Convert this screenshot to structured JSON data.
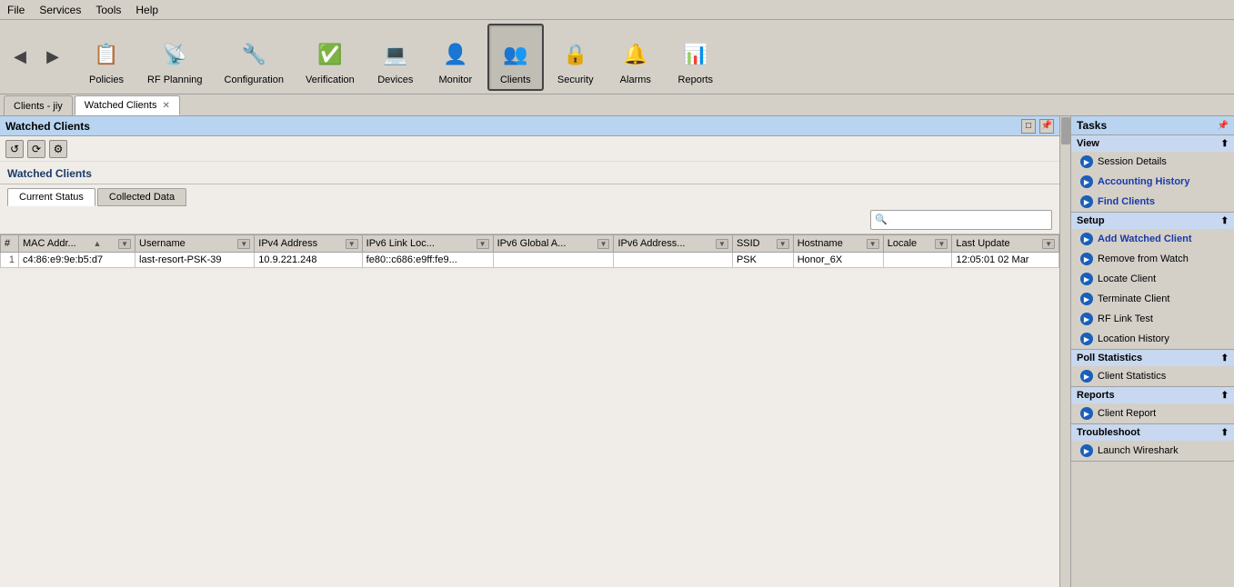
{
  "menu": {
    "items": [
      "File",
      "Services",
      "Tools",
      "Help"
    ]
  },
  "toolbar": {
    "nav": {
      "back_label": "◀",
      "forward_label": "▶"
    },
    "buttons": [
      {
        "id": "policies",
        "label": "Policies",
        "icon": "📋",
        "active": false
      },
      {
        "id": "rfplanning",
        "label": "RF Planning",
        "icon": "📡",
        "active": false
      },
      {
        "id": "configuration",
        "label": "Configuration",
        "icon": "🔧",
        "active": false
      },
      {
        "id": "verification",
        "label": "Verification",
        "icon": "✅",
        "active": false
      },
      {
        "id": "devices",
        "label": "Devices",
        "icon": "💻",
        "active": false
      },
      {
        "id": "monitor",
        "label": "Monitor",
        "icon": "👤",
        "active": false
      },
      {
        "id": "clients",
        "label": "Clients",
        "icon": "👥",
        "active": true
      },
      {
        "id": "security",
        "label": "Security",
        "icon": "🔒",
        "active": false
      },
      {
        "id": "alarms",
        "label": "Alarms",
        "icon": "🔔",
        "active": false
      },
      {
        "id": "reports",
        "label": "Reports",
        "icon": "📊",
        "active": false
      }
    ]
  },
  "tabs": [
    {
      "id": "clients-jiy",
      "label": "Clients - jiy",
      "closable": false,
      "active": false
    },
    {
      "id": "watched-clients",
      "label": "Watched Clients",
      "closable": true,
      "active": true
    }
  ],
  "panel": {
    "title": "Watched Clients",
    "section_title": "Watched Clients",
    "sub_tabs": [
      {
        "id": "current-status",
        "label": "Current Status",
        "active": true
      },
      {
        "id": "collected-data",
        "label": "Collected Data",
        "active": false
      }
    ],
    "search_placeholder": "🔍",
    "table": {
      "columns": [
        {
          "id": "num",
          "label": "#",
          "sortable": false,
          "dropdown": false
        },
        {
          "id": "mac",
          "label": "MAC Addr...",
          "sortable": true,
          "dropdown": true
        },
        {
          "id": "username",
          "label": "Username",
          "sortable": false,
          "dropdown": true
        },
        {
          "id": "ipv4",
          "label": "IPv4 Address",
          "sortable": false,
          "dropdown": true
        },
        {
          "id": "ipv6link",
          "label": "IPv6 Link Loc...",
          "sortable": false,
          "dropdown": true
        },
        {
          "id": "ipv6global",
          "label": "IPv6 Global A...",
          "sortable": false,
          "dropdown": true
        },
        {
          "id": "ipv6addr",
          "label": "IPv6 Address...",
          "sortable": false,
          "dropdown": true
        },
        {
          "id": "ssid",
          "label": "SSID",
          "sortable": false,
          "dropdown": true
        },
        {
          "id": "hostname",
          "label": "Hostname",
          "sortable": false,
          "dropdown": true
        },
        {
          "id": "locale",
          "label": "Locale",
          "sortable": false,
          "dropdown": true
        },
        {
          "id": "lastupdate",
          "label": "Last Update",
          "sortable": false,
          "dropdown": true
        }
      ],
      "rows": [
        {
          "num": "1",
          "mac": "c4:86:e9:9e:b5:d7",
          "username": "last-resort-PSK-39",
          "ipv4": "10.9.221.248",
          "ipv6link": "fe80::c686:e9ff:fe9...",
          "ipv6global": "",
          "ipv6addr": "",
          "ssid": "PSK",
          "hostname": "Honor_6X",
          "locale": "",
          "lastupdate": "12:05:01  02 Mar"
        }
      ]
    }
  },
  "right_panel": {
    "title": "Tasks",
    "sections": [
      {
        "id": "view",
        "label": "View",
        "collapsible": true,
        "items": [
          {
            "id": "session-details",
            "label": "Session Details"
          },
          {
            "id": "accounting-history",
            "label": "Accounting History",
            "highlight": true
          },
          {
            "id": "find-clients",
            "label": "Find Clients",
            "highlight": true
          }
        ]
      },
      {
        "id": "setup",
        "label": "Setup",
        "collapsible": true,
        "items": [
          {
            "id": "add-watched-client",
            "label": "Add Watched Client",
            "highlight": true
          },
          {
            "id": "remove-from-watch",
            "label": "Remove from Watch"
          },
          {
            "id": "locate-client",
            "label": "Locate Client"
          },
          {
            "id": "terminate-client",
            "label": "Terminate Client"
          },
          {
            "id": "rf-link-test",
            "label": "RF Link Test"
          },
          {
            "id": "location-history",
            "label": "Location History"
          }
        ]
      },
      {
        "id": "poll-statistics",
        "label": "Poll Statistics",
        "collapsible": true,
        "items": [
          {
            "id": "client-statistics",
            "label": "Client Statistics"
          }
        ]
      },
      {
        "id": "reports",
        "label": "Reports",
        "collapsible": true,
        "items": [
          {
            "id": "client-report",
            "label": "Client Report"
          }
        ]
      },
      {
        "id": "troubleshoot",
        "label": "Troubleshoot",
        "collapsible": true,
        "items": [
          {
            "id": "launch-wireshark",
            "label": "Launch Wireshark"
          }
        ]
      }
    ]
  }
}
